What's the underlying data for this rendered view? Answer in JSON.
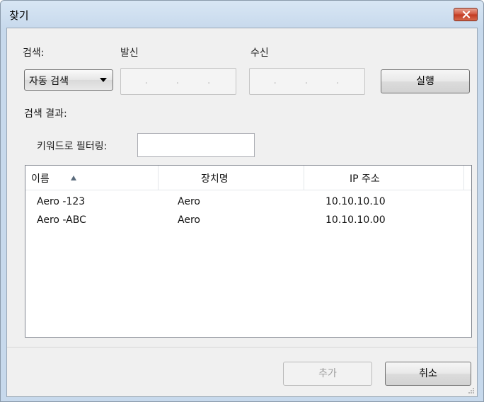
{
  "window": {
    "title": "찾기"
  },
  "search": {
    "search_label": "검색:",
    "from_label": "발신",
    "to_label": "수신",
    "mode_value": "자동 검색",
    "from_ip": ". . .",
    "to_ip": ". . .",
    "run_label": "실행"
  },
  "results": {
    "label": "검색 결과:",
    "filter_label": "키워드로 필터링:",
    "filter_value": "",
    "columns": [
      "이름",
      "장치명",
      "IP 주소"
    ],
    "rows": [
      {
        "name": "Aero -123",
        "device": "Aero",
        "ip": "10.10.10.10"
      },
      {
        "name": "Aero -ABC",
        "device": "Aero",
        "ip": "10.10.10.00"
      }
    ]
  },
  "footer": {
    "add_label": "추가",
    "cancel_label": "취소"
  },
  "colors": {
    "titlebar": "#c7d9ec",
    "close": "#c23a22",
    "panel": "#f0f0f0"
  }
}
